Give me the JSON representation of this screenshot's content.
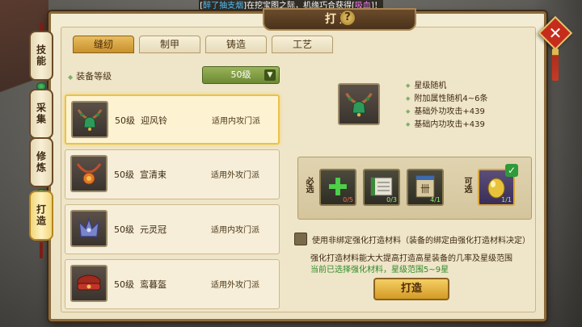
{
  "ticker": {
    "prefix": "[",
    "player": "醉了抽支烟",
    "mid": "]在挖宝图之际，机缘巧合获得[",
    "reward": "吸血",
    "suffix": "]！"
  },
  "window": {
    "title": "打造",
    "help_label": "?",
    "close_label": "✕"
  },
  "lanterns": [
    "技能",
    "采集",
    "修炼",
    "打造"
  ],
  "tabs": [
    "缝纫",
    "制甲",
    "铸造",
    "工艺"
  ],
  "filter": {
    "label": "装备等级",
    "selected": "50级"
  },
  "items": [
    {
      "level": "50级",
      "name": "迎风铃",
      "sect": "适用内攻门派",
      "icon": "bell-necklace-icon"
    },
    {
      "level": "50级",
      "name": "宣清束",
      "sect": "适用外攻门派",
      "icon": "gem-necklace-icon"
    },
    {
      "level": "50级",
      "name": "元灵冠",
      "sect": "适用内攻门派",
      "icon": "crown-icon"
    },
    {
      "level": "50级",
      "name": "鸾暮盔",
      "sect": "适用外攻门派",
      "icon": "headband-icon"
    }
  ],
  "preview": {
    "icon": "bell-necklace-icon",
    "attributes": [
      "星级随机",
      "附加属性随机4~6条",
      "基础外功攻击+439",
      "基础内功攻击+439"
    ]
  },
  "materials": {
    "required_label": "必选",
    "optional_label": "可选",
    "required": [
      {
        "icon": "plus-material-icon",
        "count": "0/5"
      },
      {
        "icon": "scroll-material-icon",
        "count": "0/3"
      },
      {
        "icon": "book-material-icon",
        "count": "4/1"
      }
    ],
    "optional": {
      "icon": "gold-egg-icon",
      "count": "1/1"
    }
  },
  "option": {
    "label": "使用非绑定强化打造材料（装备的绑定由强化打造材料决定）"
  },
  "info": {
    "line1": "强化打造材料能大大提高打造高星装备的几率及星级范围",
    "line2": "当前已选择强化材料，星级范围5~9星"
  },
  "forge_button": "打造"
}
